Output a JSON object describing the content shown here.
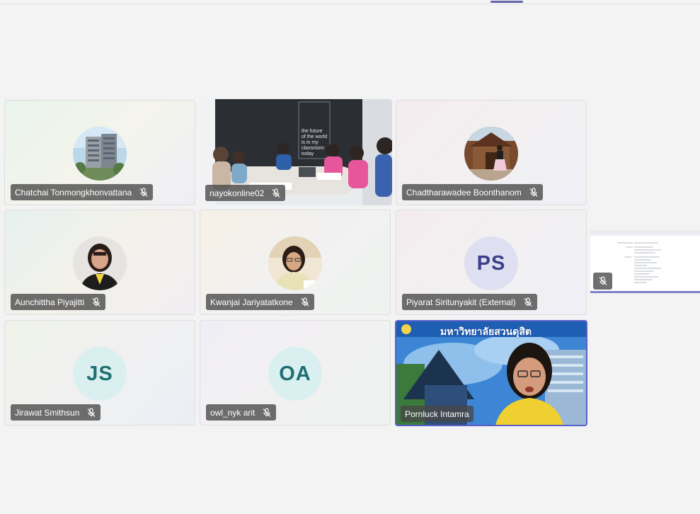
{
  "participants": [
    {
      "name": "Chatchai Tonmongkhonvattana",
      "muted": true,
      "kind": "photo",
      "photo": "building"
    },
    {
      "name": "nayokonline02",
      "muted": true,
      "kind": "video",
      "photo": "classroom-meeting"
    },
    {
      "name": "Chadtharawadee Boonthanom",
      "muted": true,
      "kind": "photo",
      "photo": "temple"
    },
    {
      "name": "Aunchittha Piyajitti",
      "muted": true,
      "kind": "photo",
      "photo": "portrait-woman"
    },
    {
      "name": "Kwanjai Jariyatatkone",
      "muted": true,
      "kind": "photo",
      "photo": "portrait-woman-smiling"
    },
    {
      "name": "Piyarat Siritunyakit (External)",
      "muted": true,
      "kind": "initials",
      "initials": "PS"
    },
    {
      "name": "Jirawat Smithsun",
      "muted": true,
      "kind": "initials",
      "initials": "JS"
    },
    {
      "name": "owl_nyk arit",
      "muted": true,
      "kind": "initials",
      "initials": "OA"
    },
    {
      "name": "Pornluck Intamra",
      "muted": false,
      "kind": "video",
      "photo": "speaker-university",
      "active_speaker": true
    }
  ],
  "video_overlay": {
    "classroom_wall_text": [
      "the future",
      "of the world",
      "is in my",
      "classroom",
      "today"
    ],
    "university_banner": "มหาวิทยาลัยสวนดุสิต"
  },
  "side_panel": {
    "content": "shared-document-thumbnail",
    "muted_icon": "mic-off-icon"
  },
  "colors": {
    "accent": "#5b5fc7",
    "background": "#f3f3f3",
    "label_bg": "#464646"
  },
  "icons": {
    "mic": "mic-off-icon"
  }
}
